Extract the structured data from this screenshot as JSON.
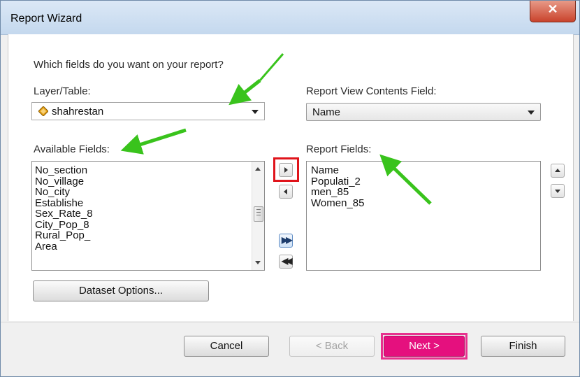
{
  "window": {
    "title": "Report Wizard",
    "close_glyph": "✕"
  },
  "prompt": "Which fields do you want on your report?",
  "layer_table": {
    "label": "Layer/Table:",
    "value": "shahrestan",
    "icon": "layer-diamond-icon"
  },
  "contents_field": {
    "label": "Report View Contents Field:",
    "value": "Name"
  },
  "available_fields": {
    "label": "Available Fields:",
    "items": [
      "No_section",
      "No_village",
      "No_city",
      "Establishe",
      "Sex_Rate_8",
      "City_Pop_8",
      "Rural_Pop_",
      "Area"
    ]
  },
  "report_fields": {
    "label": "Report Fields:",
    "items": [
      "Name",
      "Populati_2",
      "men_85",
      "Women_85"
    ]
  },
  "buttons": {
    "dataset_options": "Dataset Options...",
    "cancel": "Cancel",
    "back": "< Back",
    "next": "Next >",
    "finish": "Finish"
  },
  "colors": {
    "annotation_arrow": "#39c31c",
    "next_highlight": "#e5107e",
    "add_highlight": "#e0141b"
  }
}
